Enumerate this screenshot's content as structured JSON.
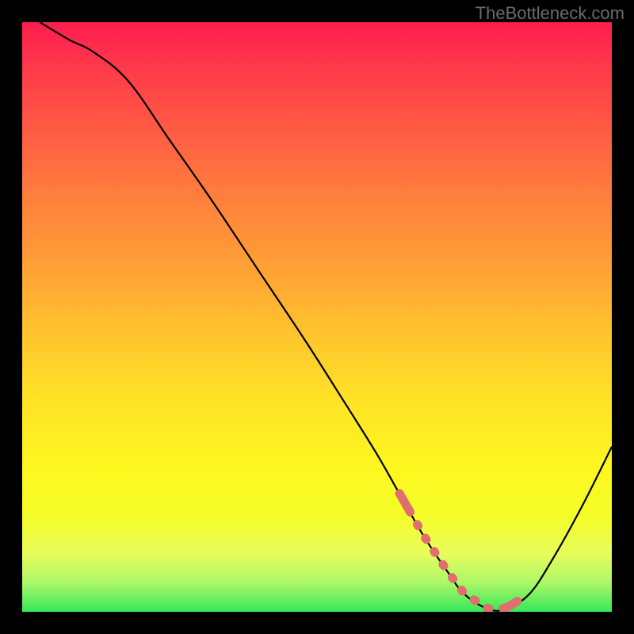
{
  "watermark": "TheBottleneck.com",
  "chart_data": {
    "type": "line",
    "title": "",
    "xlabel": "",
    "ylabel": "",
    "xlim": [
      0,
      100
    ],
    "ylim": [
      0,
      100
    ],
    "series": [
      {
        "name": "curve",
        "x": [
          3,
          8,
          12,
          18,
          25,
          32,
          40,
          48,
          55,
          60,
          64,
          68,
          72,
          75,
          79,
          82,
          86,
          90,
          95,
          100
        ],
        "y": [
          100,
          97,
          95,
          90,
          80,
          70,
          58,
          46,
          35,
          27,
          20,
          13,
          7,
          3,
          0.5,
          0.5,
          3,
          9,
          18,
          28
        ]
      }
    ],
    "highlight_range_x": [
      64,
      84
    ],
    "annotations": [],
    "grid": false,
    "legend": false,
    "background_gradient": [
      "#ff1d4e",
      "#ff7a3e",
      "#ffe326",
      "#35e85a"
    ]
  }
}
